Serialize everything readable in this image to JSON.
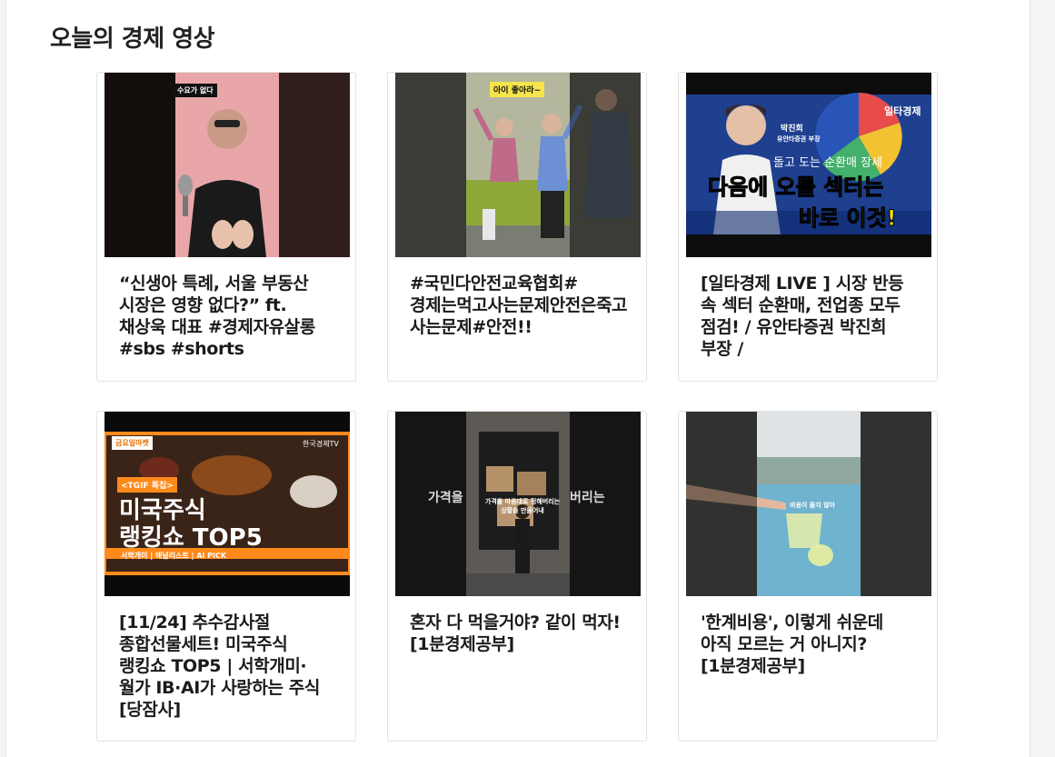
{
  "section": {
    "title": "오늘의 경제 영상"
  },
  "videos": [
    {
      "title": "“신생아 특례, 서울 부동산 시장은 영향 없다?” ft. 채상욱 대표 #경제자유살롱 #sbs #shorts",
      "overlay": "수요가 없다"
    },
    {
      "title": "#국민다안전교육협회#경제는먹고사는문제안전은죽고사는문제#안전!!",
      "overlay": "아이 좋아라~"
    },
    {
      "title": "[일타경제 LIVE ] 시장 반등 속 섹터 순환매, 전업종 모두 점검! / 유안타증권 박진희 부장 /",
      "overlay_top": "돌고 도는 순환매 장세",
      "overlay_line1": "다음에 오를 섹터는",
      "overlay_line2": "바로 이것!",
      "badge": "일타경제",
      "name": "박진희",
      "org": "유안타증권 부장"
    },
    {
      "title": "[11/24] 추수감사절 종합선물세트! 미국주식 랭킹쇼 TOP5 | 서학개미·월가 IB·AI가 사랑하는 주식 [당잠사]",
      "tag": "<TGIF 특집>",
      "line1": "미국주식",
      "line2": "랭킹쇼 TOP5",
      "bottom": "서학개미 | 애널리스트 | AI PICK",
      "channel": "한국경제TV",
      "banner": "금요일마켓"
    },
    {
      "title": "혼자 다 먹을거야? 같이 먹자! [1분경제공부]",
      "overlay_side": "가격을",
      "overlay_side2": "버리는",
      "subtitle": "가격을 마음대로 정해버리는 상황을 만들어내"
    },
    {
      "title": "'한계비용', 이렇게 쉬운데 아직 모르는 거 아니지? [1분경제공부]",
      "subtitle": "비용이 들지 않아"
    }
  ]
}
